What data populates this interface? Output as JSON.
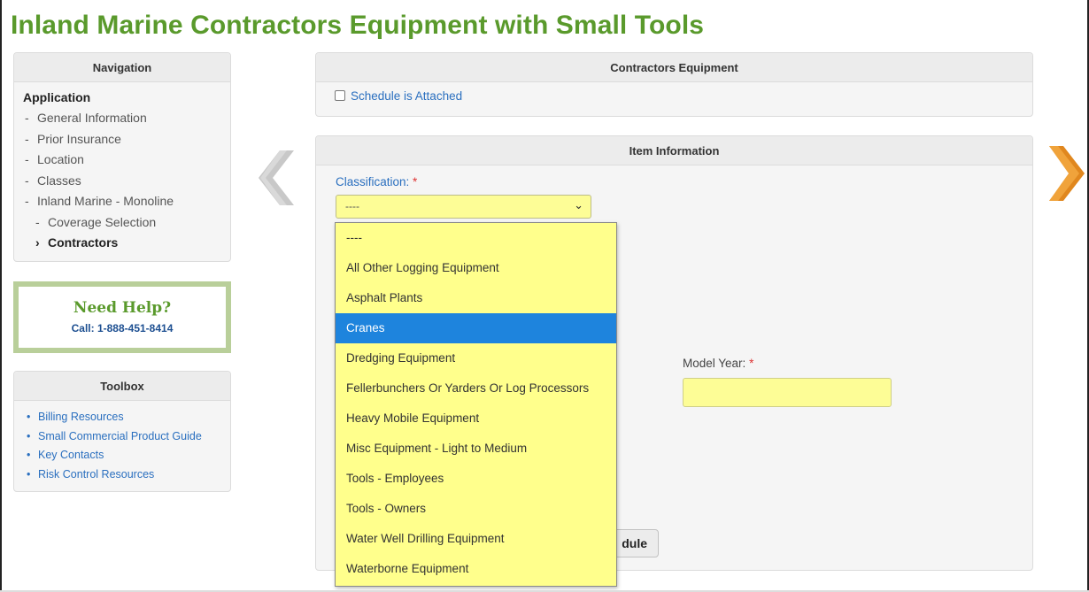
{
  "page": {
    "title": "Inland Marine Contractors Equipment with Small Tools"
  },
  "navigation": {
    "header": "Navigation",
    "group": "Application",
    "items": [
      {
        "mark": "-",
        "label": "General Information"
      },
      {
        "mark": "-",
        "label": "Prior Insurance"
      },
      {
        "mark": "-",
        "label": "Location"
      },
      {
        "mark": "-",
        "label": "Classes"
      },
      {
        "mark": "-",
        "label": "Inland Marine - Monoline"
      },
      {
        "mark": "-",
        "label": "Coverage Selection"
      },
      {
        "mark": "›",
        "label": "Contractors"
      }
    ]
  },
  "help": {
    "title": "Need Help?",
    "call": "Call: 1-888-451-8414"
  },
  "toolbox": {
    "header": "Toolbox",
    "links": [
      "Billing Resources",
      "Small Commercial Product Guide",
      "Key Contacts",
      "Risk Control Resources"
    ]
  },
  "contractors_equipment": {
    "header": "Contractors Equipment",
    "schedule_checkbox_label": "Schedule is Attached"
  },
  "item_information": {
    "header": "Item Information",
    "classification_label": "Classification:",
    "required_mark": "*",
    "classification_selected": "----",
    "model_year_label": "Model Year:",
    "schedule_button_label": "dule"
  },
  "classification_options": [
    "----",
    "All Other Logging Equipment",
    "Asphalt Plants",
    "Cranes",
    "Dredging Equipment",
    "Fellerbunchers Or Yarders Or Log Processors",
    "Heavy Mobile Equipment",
    "Misc Equipment - Light to Medium",
    "Tools - Employees",
    "Tools - Owners",
    "Water Well Drilling Equipment",
    "Waterborne Equipment"
  ],
  "highlighted_option": "Cranes",
  "colors": {
    "title_green": "#5a9a2c",
    "link_blue": "#2a6fbf",
    "field_yellow": "#fdfd96",
    "highlight_blue": "#1e84dd",
    "arrow_orange": "#e0871e",
    "arrow_gray": "#c8c8c8"
  },
  "icons": {
    "prev": "chevron-left-icon",
    "next": "chevron-right-icon",
    "select": "chevron-down-icon"
  }
}
